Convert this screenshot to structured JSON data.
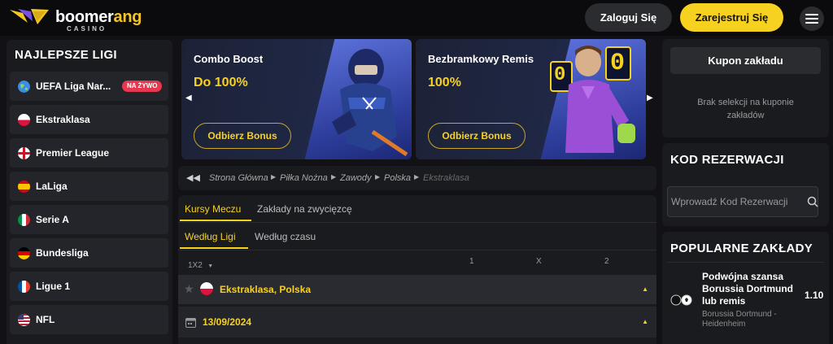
{
  "header": {
    "logo_text_main": "boomer",
    "logo_text_accent": "ang",
    "logo_sub": "CASINO",
    "login_label": "Zaloguj Się",
    "register_label": "Zarejestruj Się"
  },
  "sidebar": {
    "title": "NAJLEPSZE LIGI",
    "live_badge": "NA ŻYWO",
    "items": [
      {
        "label": "UEFA Liga Nar...",
        "flag": "globe-icon"
      },
      {
        "label": "Ekstraklasa",
        "flag": "poland-flag-icon"
      },
      {
        "label": "Premier League",
        "flag": "england-flag-icon"
      },
      {
        "label": "LaLiga",
        "flag": "spain-flag-icon"
      },
      {
        "label": "Serie A",
        "flag": "italy-flag-icon"
      },
      {
        "label": "Bundesliga",
        "flag": "germany-flag-icon"
      },
      {
        "label": "Ligue 1",
        "flag": "france-flag-icon"
      },
      {
        "label": "NFL",
        "flag": "usa-flag-icon"
      }
    ]
  },
  "banners": [
    {
      "title": "Combo Boost",
      "value": "Do 100%",
      "button": "Odbierz Bonus"
    },
    {
      "title": "Bezbramkowy Remis",
      "value": "100%",
      "button": "Odbierz Bonus",
      "score_left": "0",
      "score_right": "0"
    }
  ],
  "breadcrumb": [
    "Strona Główna",
    "Piłka Nożna",
    "Zawody",
    "Polska",
    "Ekstraklasa"
  ],
  "board": {
    "tabs_main": [
      "Kursy Meczu",
      "Zakłady na zwycięzcę"
    ],
    "tabs_sub": [
      "Według Ligi",
      "Według czasu"
    ],
    "market_select": "1X2",
    "col_labels": [
      "1",
      "X",
      "2"
    ],
    "league_row": "Ekstraklasa, Polska",
    "date_row": "13/09/2024"
  },
  "coupon": {
    "title": "Kupon zakładu",
    "empty_text": "Brak selekcji na kuponie zakładów"
  },
  "reservation": {
    "title": "KOD REZERWACJI",
    "placeholder": "Wprowadź Kod Rezerwacji"
  },
  "popular": {
    "title": "POPULARNE ZAKŁADY",
    "bet_name": "Podwójna szansa Borussia Dortmund lub remis",
    "odd": "1.10",
    "teams": "Borussia Dortmund - Heidenheim"
  },
  "colors": {
    "accent": "#f7d120",
    "live": "#e8384f",
    "bg": "#121216",
    "panel": "#1a1b1f"
  }
}
